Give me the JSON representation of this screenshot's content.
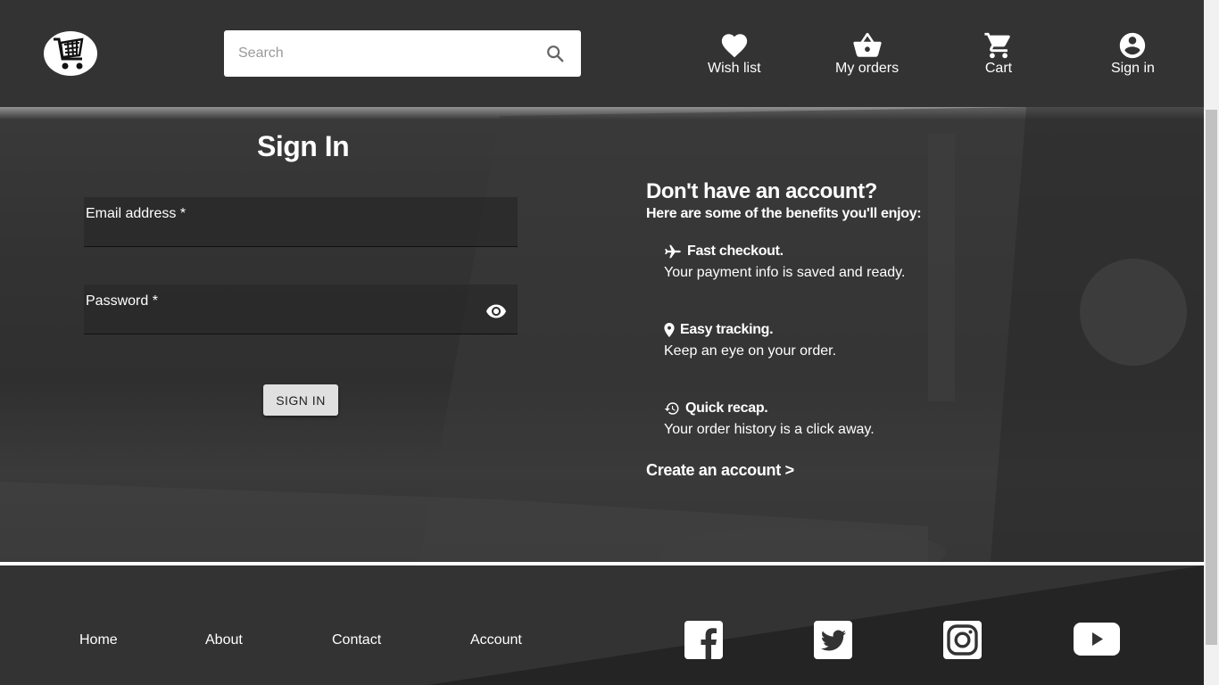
{
  "header": {
    "search_placeholder": "Search",
    "nav": [
      {
        "label": "Wish list",
        "icon": "heart-icon"
      },
      {
        "label": "My orders",
        "icon": "basket-icon"
      },
      {
        "label": "Cart",
        "icon": "cart-icon"
      },
      {
        "label": "Sign in",
        "icon": "account-icon"
      }
    ]
  },
  "signin": {
    "title": "Sign In",
    "email_label": "Email address *",
    "email_value": "",
    "password_label": "Password *",
    "password_value": "",
    "button_label": "SIGN IN"
  },
  "benefits": {
    "title": "Don't have an account?",
    "subtitle": "Here are some of the benefits you'll enjoy:",
    "items": [
      {
        "icon": "airplane-icon",
        "heading": "Fast checkout.",
        "text": "Your payment info is saved and ready."
      },
      {
        "icon": "location-pin-icon",
        "heading": "Easy tracking.",
        "text": "Keep an eye on your order."
      },
      {
        "icon": "history-icon",
        "heading": "Quick recap.",
        "text": "Your order history is a click away."
      }
    ],
    "create_link": "Create an account >"
  },
  "footer": {
    "links": [
      "Home",
      "About",
      "Contact",
      "Account"
    ],
    "social": [
      "facebook-icon",
      "twitter-icon",
      "instagram-icon",
      "youtube-icon"
    ]
  },
  "colors": {
    "header_bg": "#333333",
    "search_bg": "#ffffff",
    "button_bg": "#e0e0e0",
    "text": "#ffffff"
  }
}
